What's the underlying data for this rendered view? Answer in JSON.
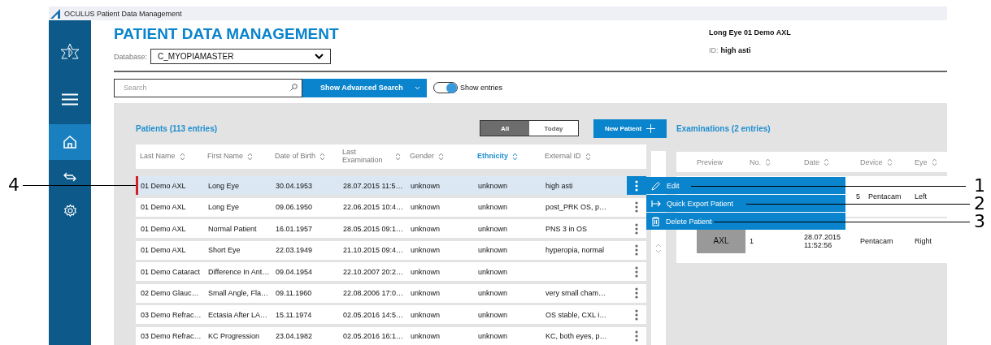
{
  "window": {
    "title": "OCULUS Patient Data Management"
  },
  "sidebar": {
    "items": [
      {
        "selected": false
      },
      {
        "selected": false
      },
      {
        "selected": true
      },
      {
        "selected": false
      },
      {
        "selected": false
      }
    ]
  },
  "header": {
    "title": "PATIENT DATA MANAGEMENT",
    "database_label": "Database:",
    "database_value": "C_MYOPIAMASTER",
    "patient_name": "Long Eye 01 Demo AXL",
    "id_label": "ID:",
    "id_value": "high asti"
  },
  "toolbar": {
    "search_placeholder": "Search",
    "advanced_search": "Show Advanced Search",
    "toggle_label": "Show entries",
    "toggle_on": true
  },
  "patients": {
    "title": "Patients (113 entries)",
    "filters": [
      {
        "label": "All",
        "selected": true
      },
      {
        "label": "Today",
        "selected": false
      }
    ],
    "new_button": "New Patient",
    "columns": [
      {
        "label": "Last Name",
        "sorted": false
      },
      {
        "label": "First Name",
        "sorted": false
      },
      {
        "label": "Date of Birth",
        "sorted": false
      },
      {
        "label": "Last Examination",
        "sorted": false
      },
      {
        "label": "Gender",
        "sorted": false
      },
      {
        "label": "Ethnicity",
        "sorted": true
      },
      {
        "label": "External ID",
        "sorted": false
      }
    ],
    "rows": [
      {
        "selected": true,
        "cells": [
          "01 Demo AXL",
          "Long Eye",
          "30.04.1953",
          "28.07.2015 11:5…",
          "unknown",
          "unknown",
          "high asti"
        ]
      },
      {
        "selected": false,
        "cells": [
          "01 Demo AXL",
          "Long Eye",
          "09.06.1950",
          "22.06.2015 10:4…",
          "unknown",
          "unknown",
          "post_PRK OS, p…"
        ]
      },
      {
        "selected": false,
        "cells": [
          "01 Demo AXL",
          "Normal Patient",
          "16.01.1957",
          "28.05.2015 09:1…",
          "unknown",
          "unknown",
          "PNS 3 in OS"
        ]
      },
      {
        "selected": false,
        "cells": [
          "01 Demo AXL",
          "Short Eye",
          "22.03.1949",
          "21.10.2015 09:4…",
          "unknown",
          "unknown",
          "hyperopia, normal"
        ]
      },
      {
        "selected": false,
        "cells": [
          "01 Demo Cataract",
          "Difference In Ant…",
          "09.04.1954",
          "22.10.2007 20:2…",
          "unknown",
          "unknown",
          ""
        ]
      },
      {
        "selected": false,
        "cells": [
          "02 Demo Glauc…",
          "Small Angle, Fla…",
          "09.11.1960",
          "22.08.2006 17:0…",
          "unknown",
          "unknown",
          "very small cham…"
        ]
      },
      {
        "selected": false,
        "cells": [
          "03 Demo Refrac…",
          "Ectasia After LA…",
          "15.11.1974",
          "02.05.2016 14:5…",
          "unknown",
          "unknown",
          "OS stable, CXL i…"
        ]
      },
      {
        "selected": false,
        "cells": [
          "03 Demo Refrac…",
          "KC Progression",
          "23.04.1982",
          "02.05.2016 16:1…",
          "unknown",
          "unknown",
          "KC, both eyes, p…"
        ]
      }
    ]
  },
  "context_menu": {
    "items": [
      {
        "label": "Edit"
      },
      {
        "label": "Quick Export Patient"
      },
      {
        "label": "Delete Patient"
      }
    ]
  },
  "examinations": {
    "title": "Examinations (2 entries)",
    "columns": [
      "Preview",
      "No.",
      "Date",
      "Device",
      "Eye"
    ],
    "rows": [
      {
        "preview": "",
        "no": "",
        "date": "5",
        "device": "Pentacam",
        "eye": "Left"
      },
      {
        "preview": "AXL",
        "no": "1",
        "date": "28.07.2015 11:52:56",
        "device": "Pentacam",
        "eye": "Right"
      }
    ]
  },
  "callouts": [
    {
      "number": "4"
    },
    {
      "number": "1"
    },
    {
      "number": "2"
    },
    {
      "number": "3"
    }
  ]
}
